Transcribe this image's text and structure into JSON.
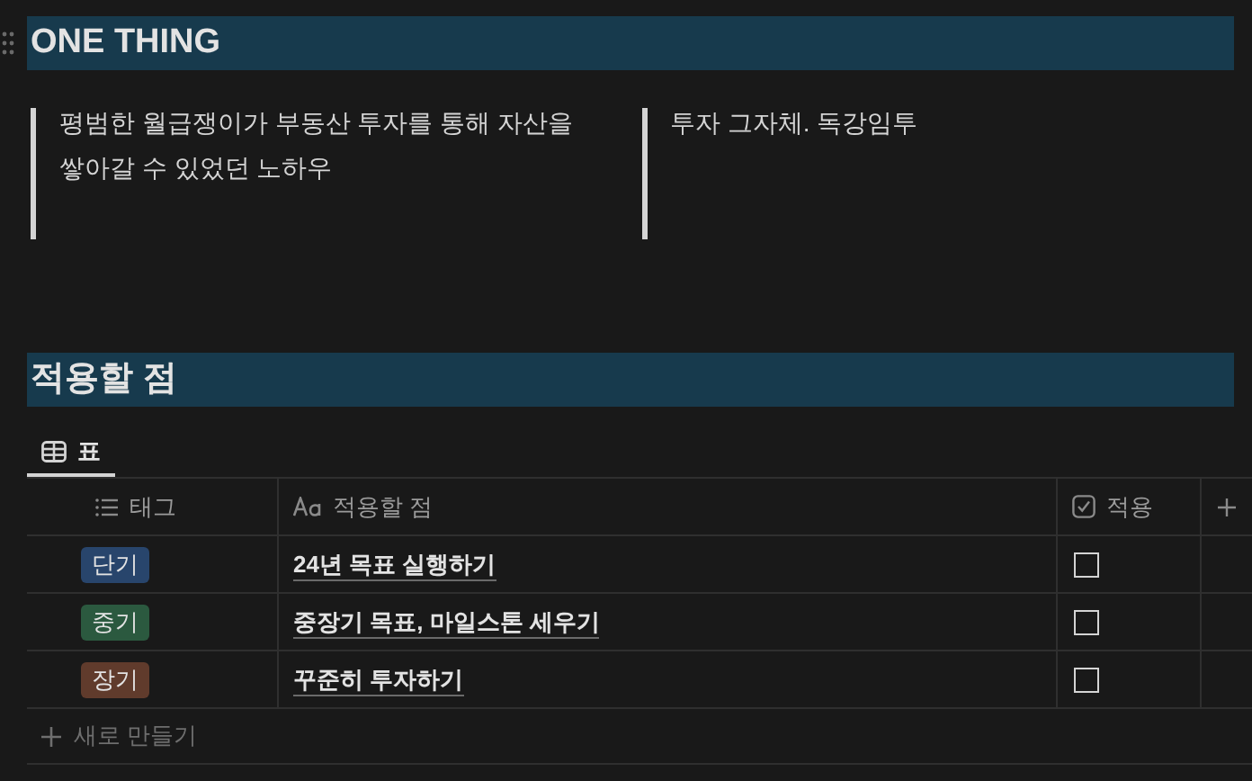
{
  "sections": [
    {
      "heading": "ONE THING",
      "quotes": [
        "평범한 월급쟁이가 부동산 투자를 통해 자산을 쌓아갈 수 있었던 노하우",
        "투자 그자체. 독강임투"
      ]
    },
    {
      "heading": "적용할 점",
      "database": {
        "views": [
          {
            "label": "표",
            "selected": true
          }
        ],
        "columns": [
          {
            "kind": "tags",
            "label": "태그"
          },
          {
            "kind": "title",
            "label": "적용할 점"
          },
          {
            "kind": "checkbox",
            "label": "적용"
          }
        ],
        "rows": [
          {
            "tag": {
              "label": "단기",
              "color": "#28456c"
            },
            "title": "24년 목표 실행하기",
            "checked": false
          },
          {
            "tag": {
              "label": "중기",
              "color": "#2b593f"
            },
            "title": "중장기 목표, 마일스톤 세우기",
            "checked": false
          },
          {
            "tag": {
              "label": "장기",
              "color": "#603b2c"
            },
            "title": "꾸준히 투자하기",
            "checked": false
          }
        ],
        "new_row": "새로 만들기"
      }
    }
  ]
}
